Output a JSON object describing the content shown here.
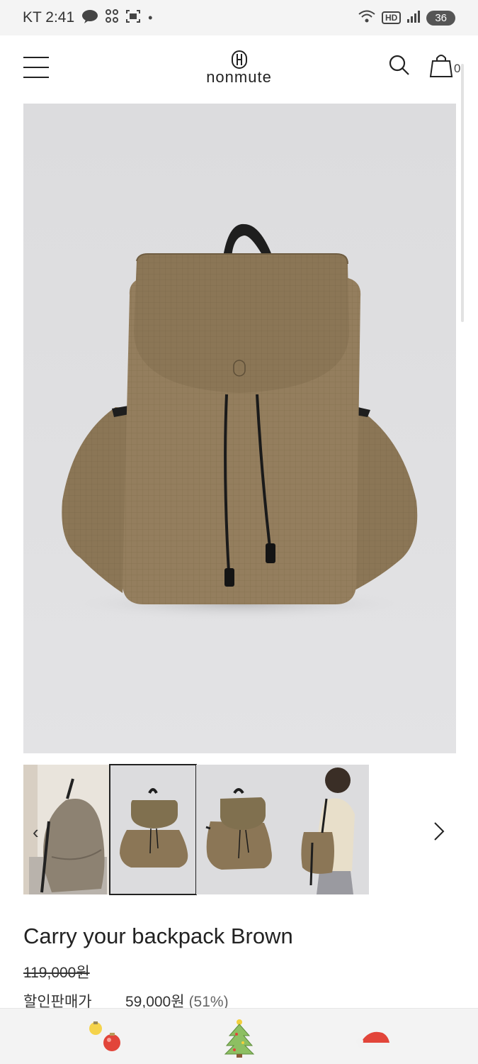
{
  "status_bar": {
    "carrier_time": "KT 2:41",
    "battery": "36",
    "icons": [
      "talk-icon",
      "apps-icon",
      "screenshot-icon",
      "dot-icon",
      "wifi-icon",
      "hd-icon",
      "signal-icon"
    ],
    "hd_label": "HD"
  },
  "header": {
    "brand": "nonmute",
    "cart_count": "0",
    "icons": [
      "menu-icon",
      "brand-logo-icon",
      "search-icon",
      "shopping-bag-icon"
    ]
  },
  "gallery": {
    "main_image": "brown-backpack-front",
    "thumbnails": [
      "model-back-view",
      "backpack-front",
      "backpack-angle",
      "model-side-view"
    ],
    "active_index": 1,
    "prev_label": "‹"
  },
  "product": {
    "name": "Carry your backpack Brown",
    "original_price": "119,000원",
    "sale_label": "할인판매가",
    "sale_price": "59,000원",
    "discount": "(51%)"
  },
  "bottom_bar": {
    "items": [
      "ornament-bulb-icon",
      "christmas-tree-icon",
      "santa-hat-icon"
    ]
  },
  "colors": {
    "bag_brown": "#8b7656",
    "background_gray": "#dcdcde",
    "text_dark": "#222222"
  }
}
